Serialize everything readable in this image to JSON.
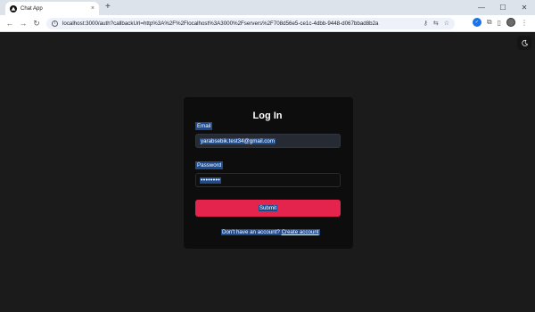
{
  "browser": {
    "tab_title": "Chat App",
    "tab_close": "×",
    "new_tab": "+",
    "url": "localhost:3000/auth?callbackUrl=http%3A%2F%2Flocalhost%3A3000%2Fservers%2F708d56e5-ce1c-4dbb-9448-d067bbad8b2a",
    "window_controls": {
      "minimize": "—",
      "maximize": "☐",
      "close": "✕"
    },
    "nav": {
      "back": "←",
      "forward": "→",
      "reload": "↻"
    }
  },
  "page": {
    "theme_toggle_icon": "moon-icon",
    "title": "Log In",
    "email": {
      "label": "Email",
      "value": "yarabsebik.test34@gmail.com"
    },
    "password": {
      "label": "Password",
      "value": "••••••••"
    },
    "submit_label": "Submit",
    "signup_prompt": "Don't have an account?",
    "signup_link": "Create account"
  },
  "colors": {
    "page_bg": "#1b1b1b",
    "card_bg": "#0d0d0d",
    "submit": "#e5244e",
    "selection": "#1f4a8c"
  }
}
